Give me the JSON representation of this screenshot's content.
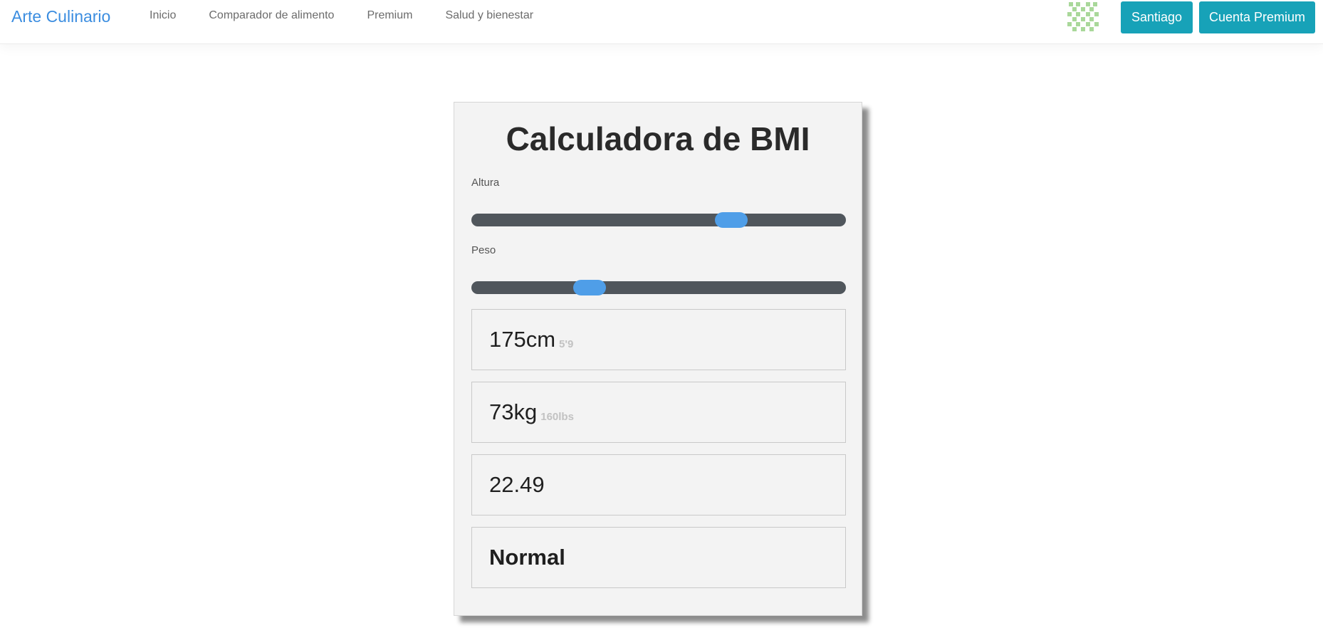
{
  "navbar": {
    "brand": "Arte Culinario",
    "links": [
      "Inicio",
      "Comparador de alimento",
      "Premium",
      "Salud y bienestar"
    ],
    "user_button": "Santiago",
    "premium_button": "Cuenta Premium",
    "avatar_color": "#9bd28a"
  },
  "calculator": {
    "title": "Calculadora de BMI",
    "height_label": "Altura",
    "weight_label": "Peso",
    "height_slider_fraction": 0.694,
    "weight_slider_fraction": 0.315,
    "height_value": "175cm",
    "height_imperial": "5'9",
    "weight_value": "73kg",
    "weight_imperial": "160lbs",
    "bmi_value": "22.49",
    "bmi_category": "Normal"
  },
  "colors": {
    "accent": "#17a2b8",
    "brand": "#3b8de0",
    "slider_track": "#50565c",
    "slider_thumb": "#4f9ee8"
  }
}
